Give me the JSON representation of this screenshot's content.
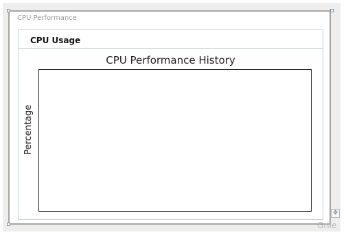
{
  "window": {
    "title": "CPU Performance"
  },
  "group": {
    "title": "CPU Usage"
  },
  "chart": {
    "title": "CPU Performance History",
    "ylabel": "Percentage"
  },
  "chart_data": {
    "type": "line",
    "title": "CPU Performance History",
    "xlabel": "",
    "ylabel": "Percentage",
    "series": [],
    "grid": false
  },
  "watermark": {
    "text": "Grile"
  },
  "icons": {
    "resize_grip": "move-grip-icon"
  }
}
